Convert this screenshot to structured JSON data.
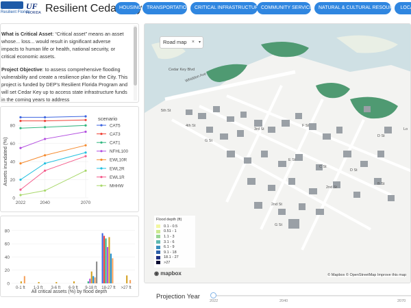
{
  "header": {
    "logo_a_text": "Resilient Florida",
    "logo_uf_text": "UF",
    "logo_uf_sub": "FLORIDA",
    "title": "Resilient Cedar Key",
    "nav": [
      "HOUSING",
      "TRANSPORTATION",
      "CRITICAL INFRASTRUCTURE",
      "COMMUNITY SERVICES",
      "NATURAL & CULTURAL RESOURCES",
      "LOCAL"
    ]
  },
  "info": {
    "p1_label": "What is Critical Asset",
    "p1_text": ": “Critical asset” means an asset whose... loss... would result in significant adverse impacts to human life or health, national security, or critical economic assets.",
    "p2_label": "Project Objective",
    "p2_text": ": to assess comprehensive flooding vulnerability and create a resilience plan for the City. This project is funded by DEP’s Resilient Florida Program and will set Cedar Key up to access state infrastructure funds in the coming years to address"
  },
  "line_chart": {
    "ylabel": "Assets inundated (%)",
    "legend_title": "scenario",
    "yticks": [
      "0",
      "20",
      "40",
      "60",
      "80"
    ],
    "xticks": [
      "2022",
      "2040",
      "2070"
    ]
  },
  "bar_chart": {
    "xlabel": "All critical assets (%) by flood depth",
    "yticks": [
      "0",
      "20",
      "40",
      "60",
      "80"
    ]
  },
  "chart_data": [
    {
      "type": "line",
      "x": [
        2022,
        2040,
        2070
      ],
      "xlim": [
        2020,
        2072
      ],
      "ylim": [
        0,
        90
      ],
      "xlabel": "",
      "ylabel": "Assets inundated (%)",
      "legend_title": "scenario",
      "legend_position": "right",
      "series": [
        {
          "name": "CAT5",
          "color": "#3b63e0",
          "values": [
            89,
            89,
            90
          ]
        },
        {
          "name": "CAT3",
          "color": "#ef4136",
          "values": [
            85,
            85,
            86
          ]
        },
        {
          "name": "CAT1",
          "color": "#2fb67e",
          "values": [
            77,
            78,
            80
          ]
        },
        {
          "name": "NFHL100",
          "color": "#b34fe0",
          "values": [
            55,
            65,
            73
          ]
        },
        {
          "name": "EWL10R",
          "color": "#f58a2e",
          "values": [
            38,
            47,
            58
          ]
        },
        {
          "name": "EWL2R",
          "color": "#22c0e0",
          "values": [
            20,
            38,
            50
          ]
        },
        {
          "name": "EWL1R",
          "color": "#f45d8c",
          "values": [
            9,
            30,
            46
          ]
        },
        {
          "name": "MHHW",
          "color": "#a8d86a",
          "values": [
            3,
            8,
            30
          ]
        }
      ]
    },
    {
      "type": "bar",
      "categories": [
        "0-1 ft",
        "1-3 ft",
        "3-6 ft",
        "6-9 ft",
        "9-18 ft",
        "18-27 ft",
        ">27 ft"
      ],
      "xlabel": "All critical assets (%) by flood depth",
      "ylim": [
        0,
        85
      ],
      "series": [
        {
          "color": "#3b63e0",
          "values": [
            0,
            0,
            0,
            0,
            0,
            76,
            0
          ]
        },
        {
          "color": "#ef4136",
          "values": [
            0,
            0,
            0,
            0,
            0,
            72,
            0
          ]
        },
        {
          "color": "#2fb67e",
          "values": [
            0,
            0,
            0,
            0,
            3,
            68,
            0
          ]
        },
        {
          "color": "#b34fe0",
          "values": [
            0,
            0,
            0,
            0,
            7,
            55,
            0
          ]
        },
        {
          "color": "#d4a020",
          "values": [
            3,
            2,
            2,
            3,
            18,
            70,
            12
          ]
        },
        {
          "color": "#1e8fcf",
          "values": [
            0,
            0,
            0,
            0,
            11,
            45,
            0
          ]
        },
        {
          "color": "#f5a05a",
          "values": [
            11,
            0,
            0,
            0,
            9,
            38,
            5
          ]
        },
        {
          "color": "#888888",
          "values": [
            0,
            0,
            0,
            0,
            33,
            0,
            0
          ]
        }
      ]
    }
  ],
  "map": {
    "style_select": "Road map",
    "legend_title": "Flood depth (ft)",
    "legend": [
      {
        "label": "0.1 - 0.5",
        "color": "#f2f7a0"
      },
      {
        "label": "0.51 - 1",
        "color": "#cbe98f"
      },
      {
        "label": "1.1 - 3",
        "color": "#99d594"
      },
      {
        "label": "3.1 - 6",
        "color": "#5db8b0"
      },
      {
        "label": "6.1 - 9",
        "color": "#3a8fbf"
      },
      {
        "label": "9.1 - 18",
        "color": "#2c5fa8"
      },
      {
        "label": "18.1 - 27",
        "color": "#1f2f80"
      },
      {
        "label": ">27",
        "color": "#0a0a30"
      }
    ],
    "mapbox_logo": "mapbox",
    "attribution": "© Mapbox © OpenStreetMap  Improve this map",
    "streets": [
      "Cedar Key Blvd",
      "Whiddon Ave",
      "5th St",
      "4th St",
      "3rd St",
      "2nd St",
      "G St",
      "F St",
      "D St",
      "E St",
      "B St",
      "C St",
      "D St",
      "G St",
      "2nd St",
      "Lo"
    ]
  },
  "projection": {
    "label": "Projection Year",
    "ticks": [
      "2022",
      "2040",
      "2070"
    ],
    "value": 2022
  }
}
